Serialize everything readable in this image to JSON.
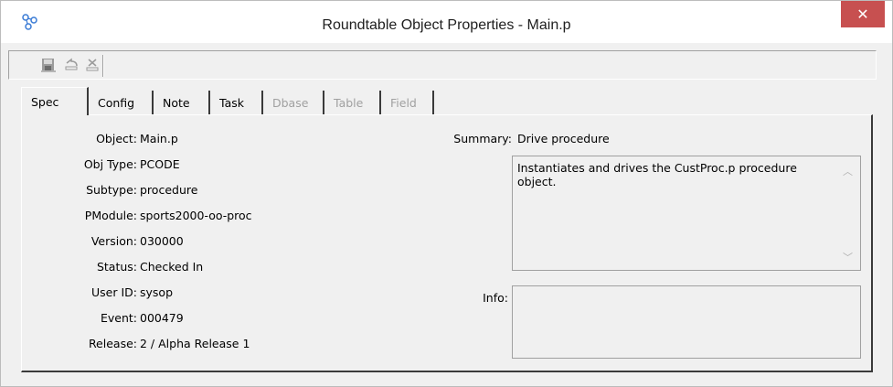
{
  "window": {
    "title": "Roundtable Object Properties - Main.p",
    "close_glyph": "✕"
  },
  "toolbar": {
    "buttons": [
      {
        "icon": "save-icon"
      },
      {
        "icon": "undo-icon"
      },
      {
        "icon": "delete-icon"
      }
    ]
  },
  "tabs": [
    {
      "label": "Spec",
      "state": "active"
    },
    {
      "label": "Config",
      "state": "enabled"
    },
    {
      "label": "Note",
      "state": "enabled"
    },
    {
      "label": "Task",
      "state": "enabled"
    },
    {
      "label": "Dbase",
      "state": "disabled"
    },
    {
      "label": "Table",
      "state": "disabled"
    },
    {
      "label": "Field",
      "state": "disabled"
    }
  ],
  "spec": {
    "fields": [
      {
        "label": "Object:",
        "value": "Main.p"
      },
      {
        "label": "Obj Type:",
        "value": "PCODE"
      },
      {
        "label": "Subtype:",
        "value": "procedure"
      },
      {
        "label": "PModule:",
        "value": "sports2000-oo-proc"
      },
      {
        "label": "Version:",
        "value": "030000"
      },
      {
        "label": "Status:",
        "value": "Checked In"
      },
      {
        "label": "User ID:",
        "value": "sysop"
      },
      {
        "label": "Event:",
        "value": "000479"
      },
      {
        "label": "Release:",
        "value": "2 / Alpha Release 1"
      }
    ],
    "summary_label": "Summary:",
    "summary_value": "Drive procedure",
    "description": "Instantiates and drives the CustProc.p procedure object.",
    "info_label": "Info:",
    "info_value": ""
  },
  "colors": {
    "close_button": "#c75050",
    "window_bg": "#f0f0f0",
    "disabled_text": "#a0a0a0"
  }
}
